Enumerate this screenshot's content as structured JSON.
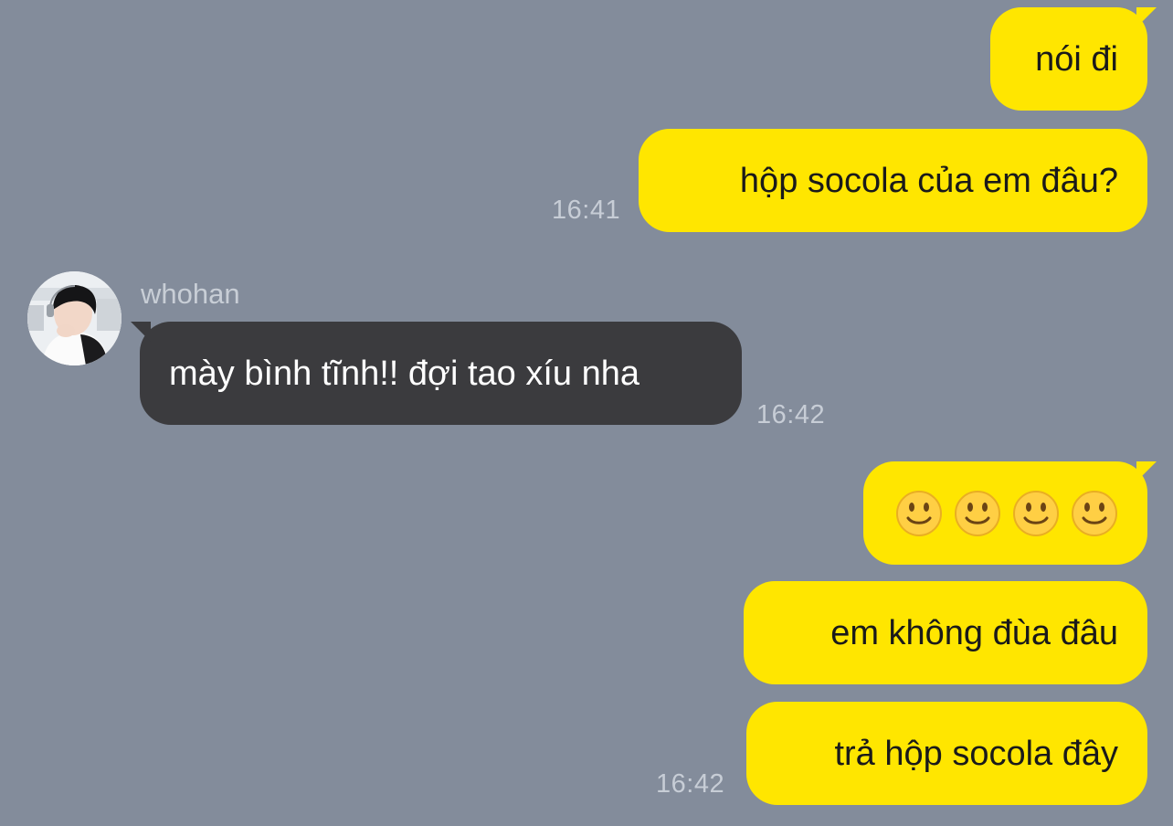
{
  "conversation": {
    "messages_me_1": {
      "text_1": "nói đi",
      "text_2": "hộp socola của em đâu?",
      "time": "16:41"
    },
    "messages_them": {
      "sender_name": "whohan",
      "text": "mày bình tĩnh!! đợi tao xíu nha",
      "time": "16:42"
    },
    "messages_me_2": {
      "emoji_icon": "slightly-smiling-face-icon",
      "text_2": "em không đùa đâu",
      "text_3": "trả hộp socola đây",
      "time": "16:42"
    }
  },
  "colors": {
    "background": "#838c9b",
    "my_bubble": "#ffe600",
    "their_bubble": "#3b3b3e",
    "timestamp": "#c7cdd6"
  }
}
